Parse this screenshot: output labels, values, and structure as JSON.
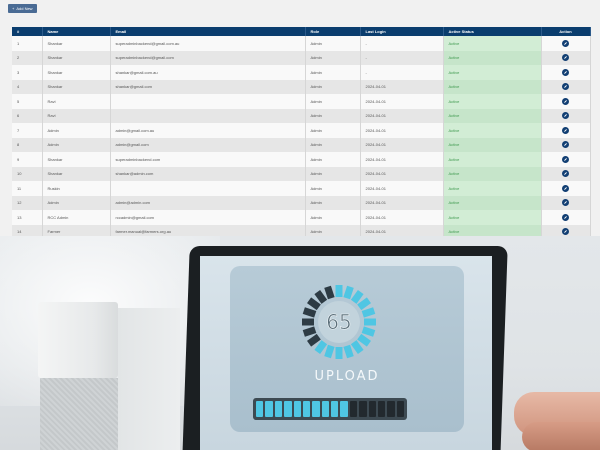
{
  "toolbar": {
    "add_label": "Add New"
  },
  "table": {
    "headers": [
      "#",
      "Name",
      "Email",
      "Role",
      "Last Login",
      "Active Status",
      "Action"
    ],
    "rows": [
      {
        "num": "1",
        "name": "Shankar",
        "email": "superadminbackend@gmail.com.au",
        "role": "Admin",
        "last_login": "-",
        "status": "Active"
      },
      {
        "num": "2",
        "name": "Shankar",
        "email": "superadminbackend@gmail.com",
        "role": "Admin",
        "last_login": "-",
        "status": "Active"
      },
      {
        "num": "3",
        "name": "Shankar",
        "email": "shankar@gmail.com.au",
        "role": "Admin",
        "last_login": "-",
        "status": "Active"
      },
      {
        "num": "4",
        "name": "Shankar",
        "email": "shankar@gmail.com",
        "role": "Admin",
        "last_login": "2024-04-01",
        "status": "Active"
      },
      {
        "num": "5",
        "name": "Ravi",
        "email": "",
        "role": "Admin",
        "last_login": "2024-04-01",
        "status": "Active"
      },
      {
        "num": "6",
        "name": "Ravi",
        "email": "",
        "role": "Admin",
        "last_login": "2024-04-01",
        "status": "Active"
      },
      {
        "num": "7",
        "name": "Admin",
        "email": "admin@gmail.com.au",
        "role": "Admin",
        "last_login": "2024-04-01",
        "status": "Active"
      },
      {
        "num": "8",
        "name": "Admin",
        "email": "admin@gmail.com",
        "role": "Admin",
        "last_login": "2024-04-01",
        "status": "Active"
      },
      {
        "num": "9",
        "name": "Shankar",
        "email": "superadminbackend.com",
        "role": "Admin",
        "last_login": "2024-04-01",
        "status": "Active"
      },
      {
        "num": "10",
        "name": "Shankar",
        "email": "shankar@admin.com",
        "role": "Admin",
        "last_login": "2024-04-01",
        "status": "Active"
      },
      {
        "num": "11",
        "name": "Ruskin",
        "email": "",
        "role": "Admin",
        "last_login": "2024-04-01",
        "status": "Active"
      },
      {
        "num": "12",
        "name": "Admin",
        "email": "admin@admin.com",
        "role": "Admin",
        "last_login": "2024-04-01",
        "status": "Active"
      },
      {
        "num": "13",
        "name": "RCC Admin",
        "email": "rccadmin@gmail.com",
        "role": "Admin",
        "last_login": "2024-04-01",
        "status": "Active"
      },
      {
        "num": "14",
        "name": "Farmer",
        "email": "farmer.manual@farmers.org.au",
        "role": "Admin",
        "last_login": "2024-04-01",
        "status": "Active"
      }
    ]
  },
  "photo": {
    "gauge_value": "65",
    "upload_label": "UPLOAD",
    "progress_fraction": 0.625
  },
  "colors": {
    "header_bg": "#0a3d6e",
    "active_text": "#3f9a4f",
    "progress_on": "#4fc6e3"
  }
}
